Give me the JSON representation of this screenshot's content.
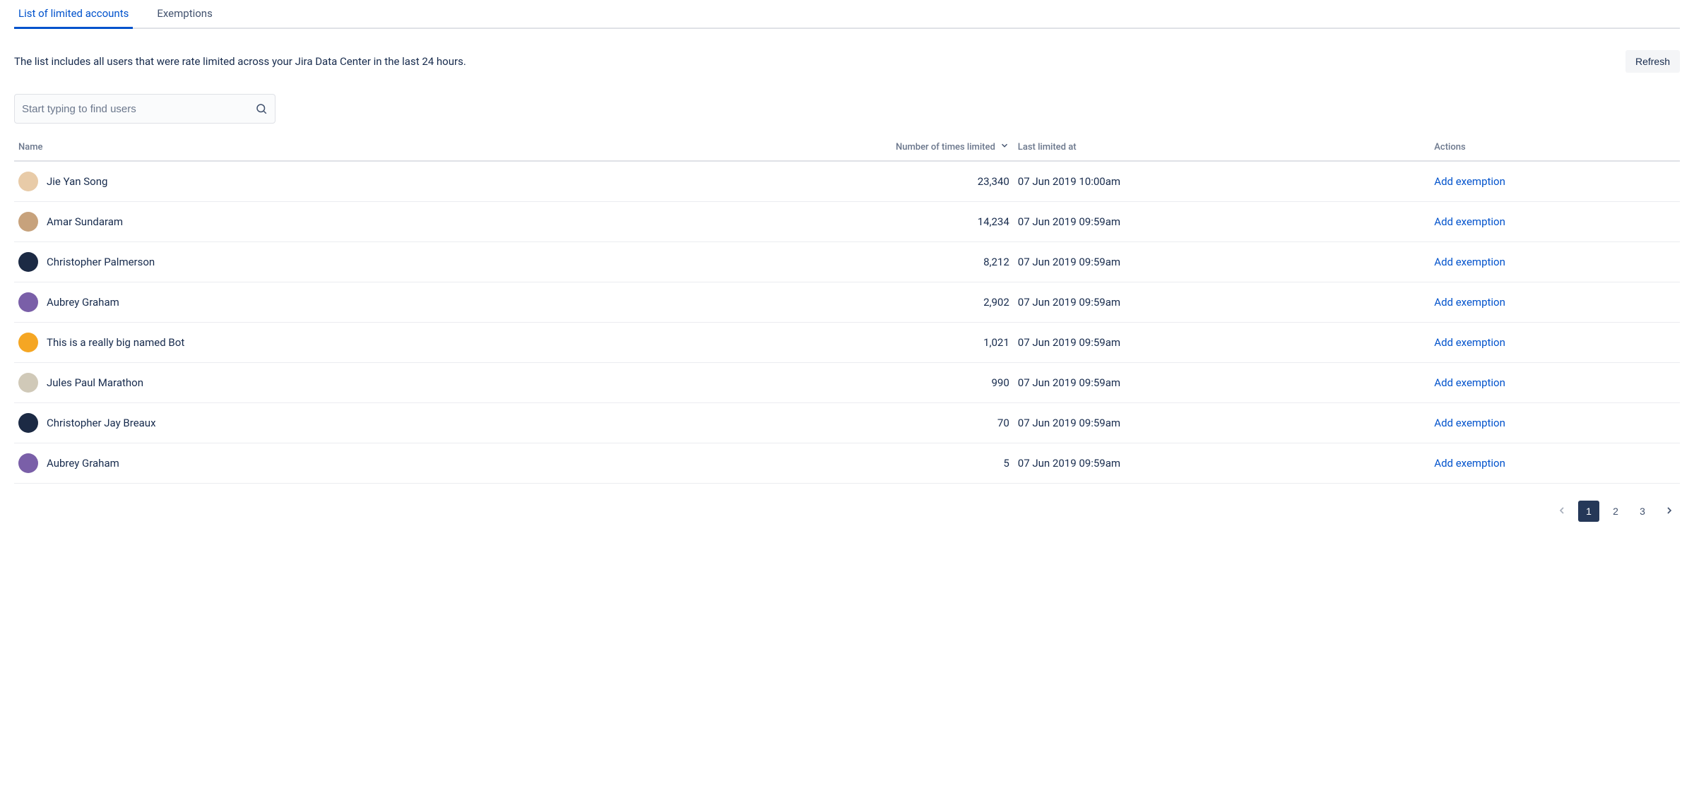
{
  "tabs": {
    "limited": "List of limited accounts",
    "exemptions": "Exemptions"
  },
  "description": "The list includes all users that were rate limited across your Jira Data Center in the last 24 hours.",
  "refresh_label": "Refresh",
  "search": {
    "placeholder": "Start typing to find users"
  },
  "columns": {
    "name": "Name",
    "count": "Number of times limited",
    "last": "Last limited at",
    "actions": "Actions"
  },
  "action_label": "Add exemption",
  "rows": [
    {
      "name": "Jie Yan Song",
      "count": "23,340",
      "last": "07 Jun 2019  10:00am",
      "avatar_bg": "#e8cba8"
    },
    {
      "name": "Amar Sundaram",
      "count": "14,234",
      "last": "07 Jun 2019  09:59am",
      "avatar_bg": "#c7a27c"
    },
    {
      "name": "Christopher Palmerson",
      "count": "8,212",
      "last": "07 Jun 2019  09:59am",
      "avatar_bg": "#1c2a44"
    },
    {
      "name": "Aubrey Graham",
      "count": "2,902",
      "last": "07 Jun 2019  09:59am",
      "avatar_bg": "#7a5fa8"
    },
    {
      "name": "This is a really big named Bot",
      "count": "1,021",
      "last": "07 Jun 2019  09:59am",
      "avatar_bg": "#f5a623"
    },
    {
      "name": "Jules Paul Marathon",
      "count": "990",
      "last": "07 Jun 2019  09:59am",
      "avatar_bg": "#d0c9b8"
    },
    {
      "name": "Christopher Jay Breaux",
      "count": "70",
      "last": "07 Jun 2019  09:59am",
      "avatar_bg": "#1c2a44"
    },
    {
      "name": "Aubrey Graham",
      "count": "5",
      "last": "07 Jun 2019  09:59am",
      "avatar_bg": "#7a5fa8"
    }
  ],
  "pagination": {
    "pages": [
      "1",
      "2",
      "3"
    ],
    "current": "1"
  }
}
